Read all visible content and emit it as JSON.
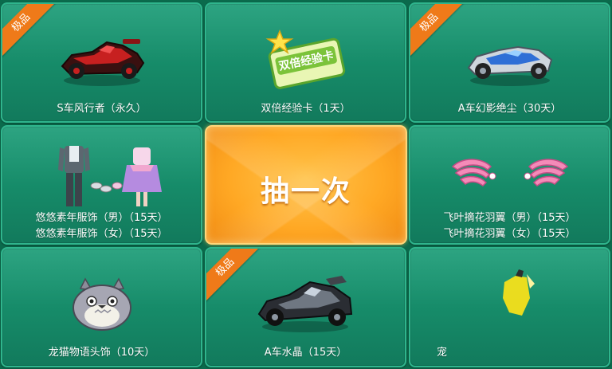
{
  "badge_label": "极品",
  "draw_button_label": "抽一次",
  "colors": {
    "background": "#0b6a4c",
    "cell": "#168a68",
    "badge": "#ef7a19",
    "draw_button": "#ffa824"
  },
  "prizes": [
    {
      "name": "S车风行者（永久）",
      "badge": true,
      "icon": "red-race-car-icon"
    },
    {
      "name": "双倍经验卡（1天）",
      "badge": false,
      "icon": "double-exp-card-icon",
      "card_text": "双倍经验卡"
    },
    {
      "name": "A车幻影绝尘（30天）",
      "badge": true,
      "icon": "silver-blue-race-car-icon"
    },
    {
      "name_lines": [
        "悠悠素年服饰（男）（15天）",
        "悠悠素年服饰（女）（15天）"
      ],
      "badge": false,
      "icon": "outfit-icon"
    },
    {
      "name_lines": [
        "飞叶摘花羽翼（男）（15天）",
        "飞叶摘花羽翼（女）（15天）"
      ],
      "badge": false,
      "icon": "pink-wings-icon"
    },
    {
      "name": "龙猫物语头饰（10天）",
      "badge": false,
      "icon": "totoro-headwear-icon"
    },
    {
      "name": "A车水晶（15天）",
      "badge": true,
      "icon": "black-race-car-icon"
    },
    {
      "name": "宠",
      "badge": false,
      "icon": "pet-icon"
    }
  ]
}
